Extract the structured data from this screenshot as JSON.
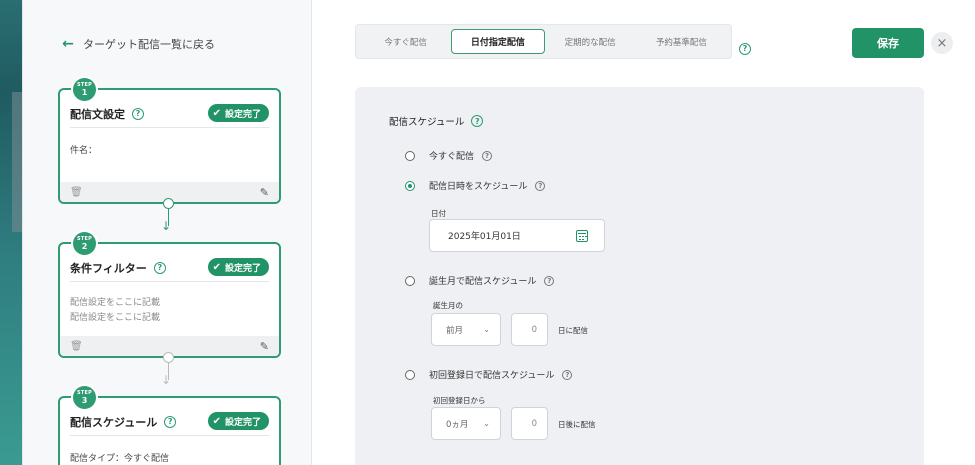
{
  "nav": {
    "back_label": "ターゲット配信一覧に戻る"
  },
  "steps": [
    {
      "badge_top": "STEP",
      "badge_num": "1",
      "title": "配信文設定",
      "status": "設定完了",
      "body_lines": [
        "件名："
      ]
    },
    {
      "badge_top": "STEP",
      "badge_num": "2",
      "title": "条件フィルター",
      "status": "設定完了",
      "body_lines": [
        "配信設定をここに記載",
        "配信設定をここに記載"
      ]
    },
    {
      "badge_top": "STEP",
      "badge_num": "3",
      "title": "配信スケジュール",
      "status": "設定完了",
      "body_lines": [
        "配信タイプ：今すぐ配信"
      ]
    }
  ],
  "tabs": [
    {
      "label": "今すぐ配信",
      "active": false
    },
    {
      "label": "日付指定配信",
      "active": true
    },
    {
      "label": "定期的な配信",
      "active": false
    },
    {
      "label": "予約基準配信",
      "active": false
    }
  ],
  "toolbar": {
    "save_label": "保存",
    "close_glyph": "×"
  },
  "schedule": {
    "title": "配信スケジュール",
    "options": [
      {
        "label": "今すぐ配信",
        "selected": false
      },
      {
        "label": "配信日時をスケジュール",
        "selected": true
      },
      {
        "label": "誕生月で配信スケジュール",
        "selected": false
      },
      {
        "label": "初回登録日で配信スケジュール",
        "selected": false
      }
    ],
    "date": {
      "label": "日付",
      "value": "2025年01月01日"
    },
    "birthday": {
      "label": "誕生月の",
      "month_value": "前月",
      "day_value": "0",
      "suffix": "日に配信"
    },
    "first_reg": {
      "label": "初回登録日から",
      "month_value": "0ヵ月",
      "day_value": "0",
      "suffix": "日後に配信"
    }
  },
  "icons": {
    "help": "?",
    "check": "✔",
    "trash": "🗑",
    "pencil": "✎",
    "chevron": "⌄",
    "back_arrow": "⬅"
  },
  "colors": {
    "accent": "#229267"
  }
}
